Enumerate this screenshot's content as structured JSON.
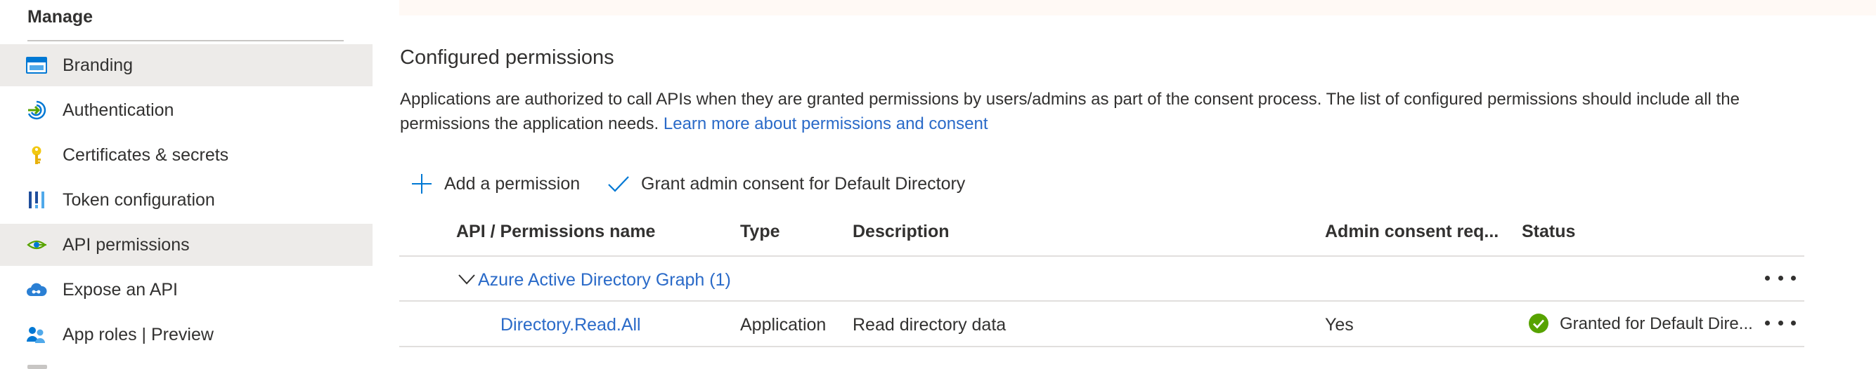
{
  "sidebar": {
    "section_title": "Manage",
    "items": [
      {
        "label": "Branding",
        "icon": "branding-icon",
        "selected": true
      },
      {
        "label": "Authentication",
        "icon": "authentication-icon",
        "selected": false
      },
      {
        "label": "Certificates & secrets",
        "icon": "key-icon",
        "selected": false
      },
      {
        "label": "Token configuration",
        "icon": "token-bars-icon",
        "selected": false
      },
      {
        "label": "API permissions",
        "icon": "api-permissions-icon",
        "selected": true
      },
      {
        "label": "Expose an API",
        "icon": "cloud-api-icon",
        "selected": false
      },
      {
        "label": "App roles | Preview",
        "icon": "app-roles-icon",
        "selected": false
      }
    ]
  },
  "main": {
    "title": "Configured permissions",
    "description": "Applications are authorized to call APIs when they are granted permissions by users/admins as part of the consent process. The list of configured permissions should include all the permissions the application needs.",
    "learn_more_link": "Learn more about permissions and consent",
    "commands": {
      "add_permission": "Add a permission",
      "grant_consent": "Grant admin consent for Default Directory"
    },
    "table": {
      "headers": {
        "api_name": "API / Permissions name",
        "type": "Type",
        "description": "Description",
        "admin_consent": "Admin consent req...",
        "status": "Status"
      },
      "group": {
        "label": "Azure Active Directory Graph (1)",
        "expanded": true
      },
      "rows": [
        {
          "name": "Directory.Read.All",
          "type": "Application",
          "description": "Read directory data",
          "admin_consent": "Yes",
          "status": "Granted for Default Dire...",
          "status_icon": "check-circle-icon"
        }
      ]
    }
  },
  "colors": {
    "link": "#2a6ac8",
    "selected_bg": "#edebe9",
    "success": "#57a300",
    "banner_bg": "#fff9f5"
  }
}
